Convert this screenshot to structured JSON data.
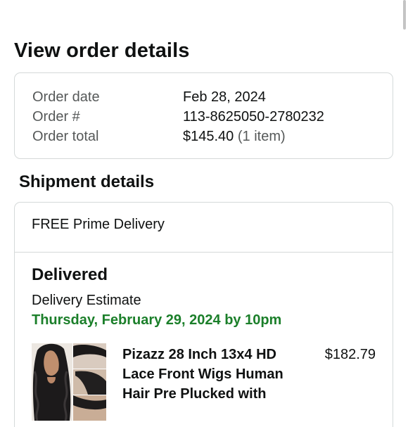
{
  "page": {
    "title": "View order details"
  },
  "order_summary": {
    "rows": [
      {
        "label": "Order date",
        "value": "Feb 28, 2024",
        "sub": ""
      },
      {
        "label": "Order #",
        "value": "113-8625050-2780232",
        "sub": ""
      },
      {
        "label": "Order total",
        "value": "$145.40",
        "sub": "(1 item)"
      }
    ]
  },
  "shipment": {
    "section_title": "Shipment details",
    "delivery_type": "FREE Prime Delivery",
    "status": "Delivered",
    "estimate_label": "Delivery Estimate",
    "estimate_date": "Thursday, February 29, 2024 by 10pm",
    "estimate_color": "#1b7f2a",
    "item": {
      "title": "Pizazz 28 Inch 13x4 HD Lace Front Wigs Human Hair Pre Plucked with",
      "price": "$182.79"
    }
  }
}
